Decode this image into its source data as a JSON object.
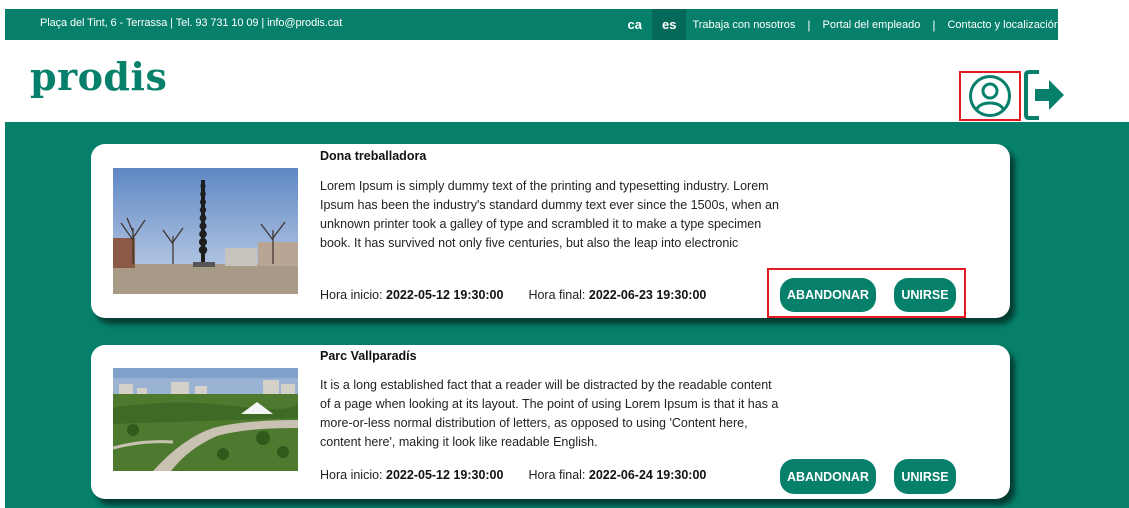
{
  "topbar": {
    "contact": "Plaça del Tint, 6 - Terrassa | Tel. 93 731 10 09 | info@prodis.cat",
    "languages": [
      "ca",
      "es"
    ],
    "active_language": "es",
    "links": [
      "Trabaja con nosotros",
      "Portal del empleado",
      "Contacto y localización"
    ],
    "separator": "|"
  },
  "header": {
    "logo": "prodis",
    "user_icon": "user-circle-icon",
    "logout_icon": "logout-arrow-icon"
  },
  "colors": {
    "brand": "#06806b",
    "highlight": "#e51b24"
  },
  "cards": [
    {
      "title": "Dona treballadora",
      "description": "Lorem Ipsum is simply dummy text of the printing and typesetting industry. Lorem Ipsum has been the industry's standard dummy text ever since the 1500s, when an unknown printer took a galley of type and scrambled it to make a type specimen book. It has survived not only five centuries, but also the leap into electronic",
      "start_label": "Hora inicio:",
      "start_value": "2022-05-12 19:30:00",
      "end_label": "Hora final:",
      "end_value": "2022-06-23 19:30:00",
      "leave_label": "ABANDONAR",
      "join_label": "UNIRSE"
    },
    {
      "title": "Parc Vallparadís",
      "description": "It is a long established fact that a reader will be distracted by the readable content of a page when looking at its layout. The point of using Lorem Ipsum is that it has a more-or-less normal distribution of letters, as opposed to using 'Content here, content here', making it look like readable English.",
      "start_label": "Hora inicio:",
      "start_value": "2022-05-12 19:30:00",
      "end_label": "Hora final:",
      "end_value": "2022-06-24 19:30:00",
      "leave_label": "ABANDONAR",
      "join_label": "UNIRSE"
    }
  ]
}
